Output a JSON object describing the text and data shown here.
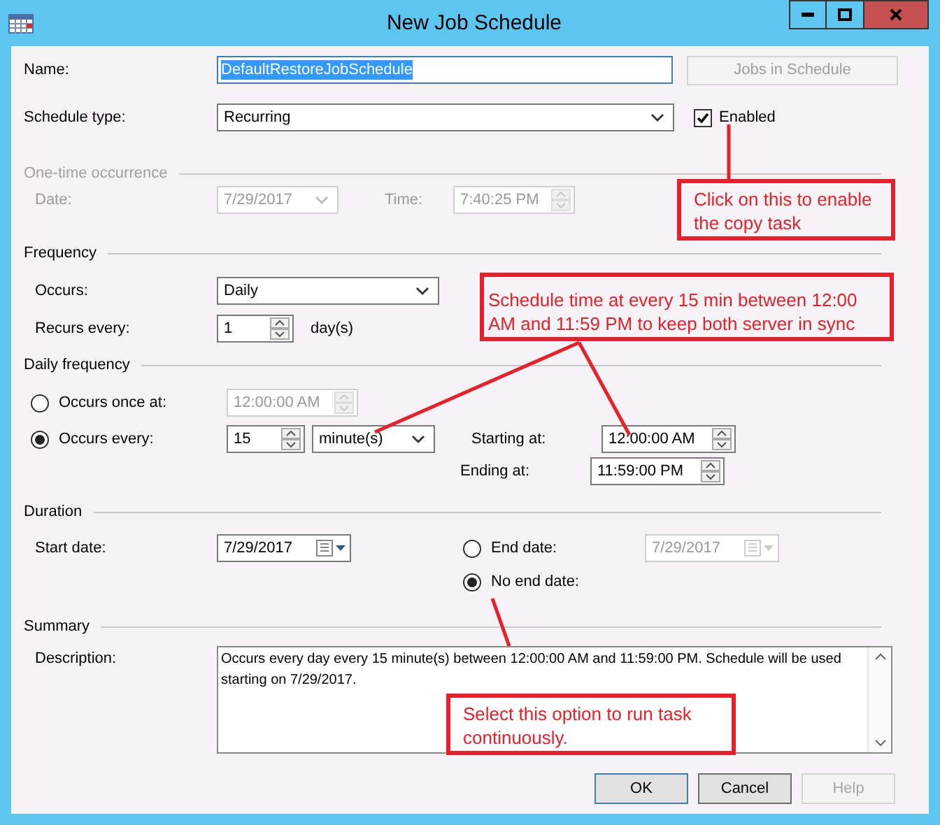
{
  "window": {
    "title": "New Job Schedule"
  },
  "name": {
    "label": "Name:",
    "value": "DefaultRestoreJobSchedule",
    "text_selected": true
  },
  "jobs_button": {
    "label": "Jobs in Schedule",
    "disabled": true
  },
  "schedule_type": {
    "label": "Schedule type:",
    "value": "Recurring"
  },
  "enabled": {
    "label": "Enabled",
    "checked": true
  },
  "one_time": {
    "title": "One-time occurrence",
    "disabled": true,
    "date_label": "Date:",
    "date": "7/29/2017",
    "time_label": "Time:",
    "time": "7:40:25 PM"
  },
  "frequency": {
    "title": "Frequency",
    "occurs_label": "Occurs:",
    "occurs": "Daily",
    "recurs_label": "Recurs every:",
    "recurs": "1",
    "recurs_unit": "day(s)"
  },
  "daily_frequency": {
    "title": "Daily frequency",
    "options": [
      {
        "label": "Occurs once at:",
        "selected": false,
        "time": "12:00:00 AM"
      },
      {
        "label": "Occurs every:",
        "selected": true,
        "interval": "15",
        "unit": "minute(s)"
      }
    ],
    "starting_label": "Starting at:",
    "starting": "12:00:00 AM",
    "ending_label": "Ending at:",
    "ending": "11:59:00 PM"
  },
  "duration": {
    "title": "Duration",
    "start_label": "Start date:",
    "start": "7/29/2017",
    "end_options": [
      {
        "label": "End date:",
        "selected": false,
        "date": "7/29/2017"
      },
      {
        "label": "No end date:",
        "selected": true
      }
    ]
  },
  "summary": {
    "title": "Summary",
    "description_label": "Description:",
    "description": "Occurs every day every 15 minute(s) between 12:00:00 AM and 11:59:00 PM. Schedule will be used starting on 7/29/2017."
  },
  "buttons": [
    {
      "label": "OK",
      "default": true,
      "disabled": false
    },
    {
      "label": "Cancel",
      "default": false,
      "disabled": false
    },
    {
      "label": "Help",
      "default": false,
      "disabled": true
    }
  ],
  "annotations": [
    {
      "text": "Click on this to enable the copy task"
    },
    {
      "text": "Schedule time at every 15 min between 12:00 AM and 11:59 PM to keep both server in sync"
    },
    {
      "text": "Select this option to run task continuously."
    }
  ]
}
